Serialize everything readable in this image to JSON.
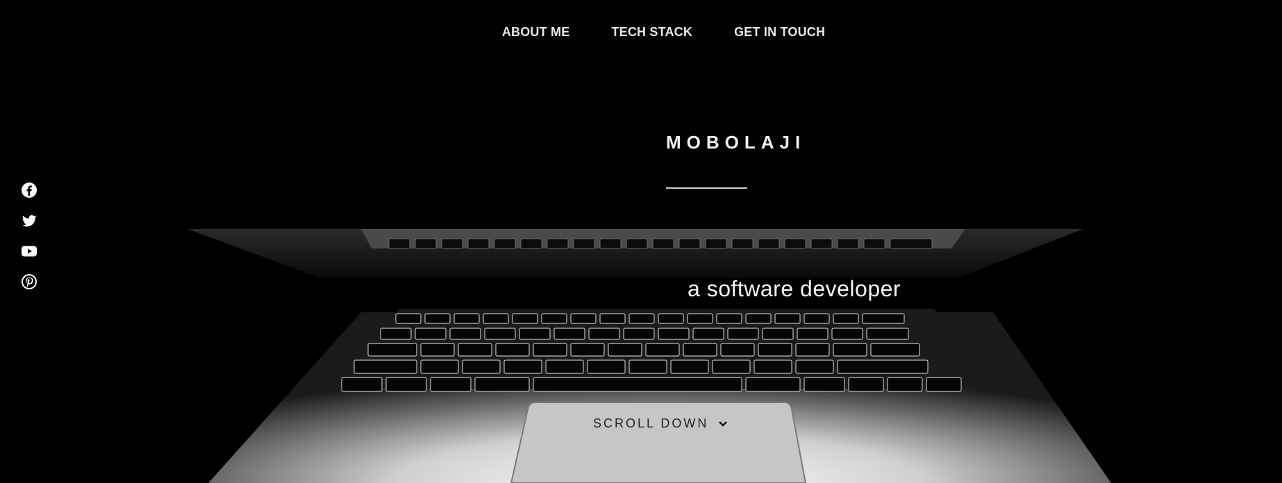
{
  "nav": {
    "items": [
      {
        "label": "ABOUT ME"
      },
      {
        "label": "TECH STACK"
      },
      {
        "label": "GET IN TOUCH"
      }
    ]
  },
  "social": {
    "icons": [
      "facebook-icon",
      "twitter-icon",
      "youtube-icon",
      "pinterest-icon"
    ]
  },
  "hero": {
    "title": "MOBOLAJI",
    "subtitle": "a software developer",
    "scroll_label": "SCROLL DOWN"
  },
  "colors": {
    "background": "#000000",
    "text": "#ffffff",
    "laptop_body": "#d9d9d9"
  }
}
